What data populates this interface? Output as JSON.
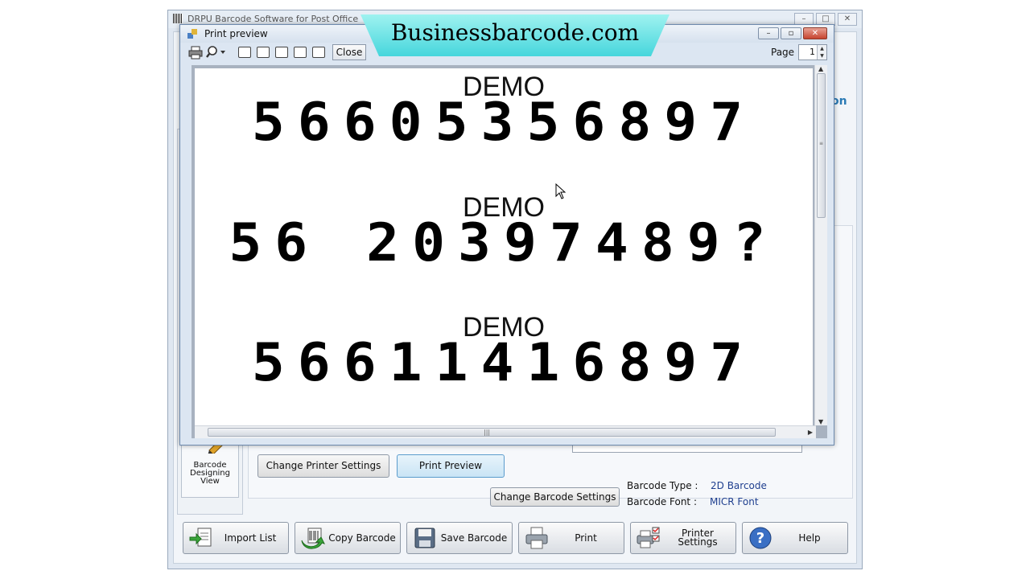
{
  "app": {
    "title": "DRPU Barcode Software for Post Office",
    "side_heading": "on",
    "designing_view_label": "Barcode Designing View",
    "buttons": {
      "change_printer_settings": "Change Printer Settings",
      "print_preview": "Print Preview",
      "change_barcode_settings": "Change Barcode Settings"
    },
    "info": {
      "barcode_type_label": "Barcode Type :",
      "barcode_type_value": "2D Barcode",
      "barcode_font_label": "Barcode Font :",
      "barcode_font_value": "MICR Font"
    },
    "toolbar": [
      {
        "label": "Import List",
        "icon": "import-list-icon"
      },
      {
        "label": "Copy Barcode",
        "icon": "copy-barcode-icon"
      },
      {
        "label": "Save Barcode",
        "icon": "save-icon"
      },
      {
        "label": "Print",
        "icon": "printer-icon"
      },
      {
        "label": "Printer Settings",
        "icon": "printer-settings-icon"
      },
      {
        "label": "Help",
        "icon": "help-icon"
      }
    ]
  },
  "preview": {
    "title": "Print preview",
    "close_label": "Close",
    "page_label": "Page",
    "page_value": "1",
    "rows": [
      {
        "demo": "DEMO",
        "digits": "56605356897"
      },
      {
        "demo": "DEMO",
        "digits": "56 20397489?"
      },
      {
        "demo": "DEMO",
        "digits": "56611416897"
      }
    ]
  },
  "watermark": "Businessbarcode.com",
  "colors": {
    "banner": "#46d6dc",
    "accent_blue": "#2a7ab5",
    "info_value": "#1f3f8f"
  }
}
